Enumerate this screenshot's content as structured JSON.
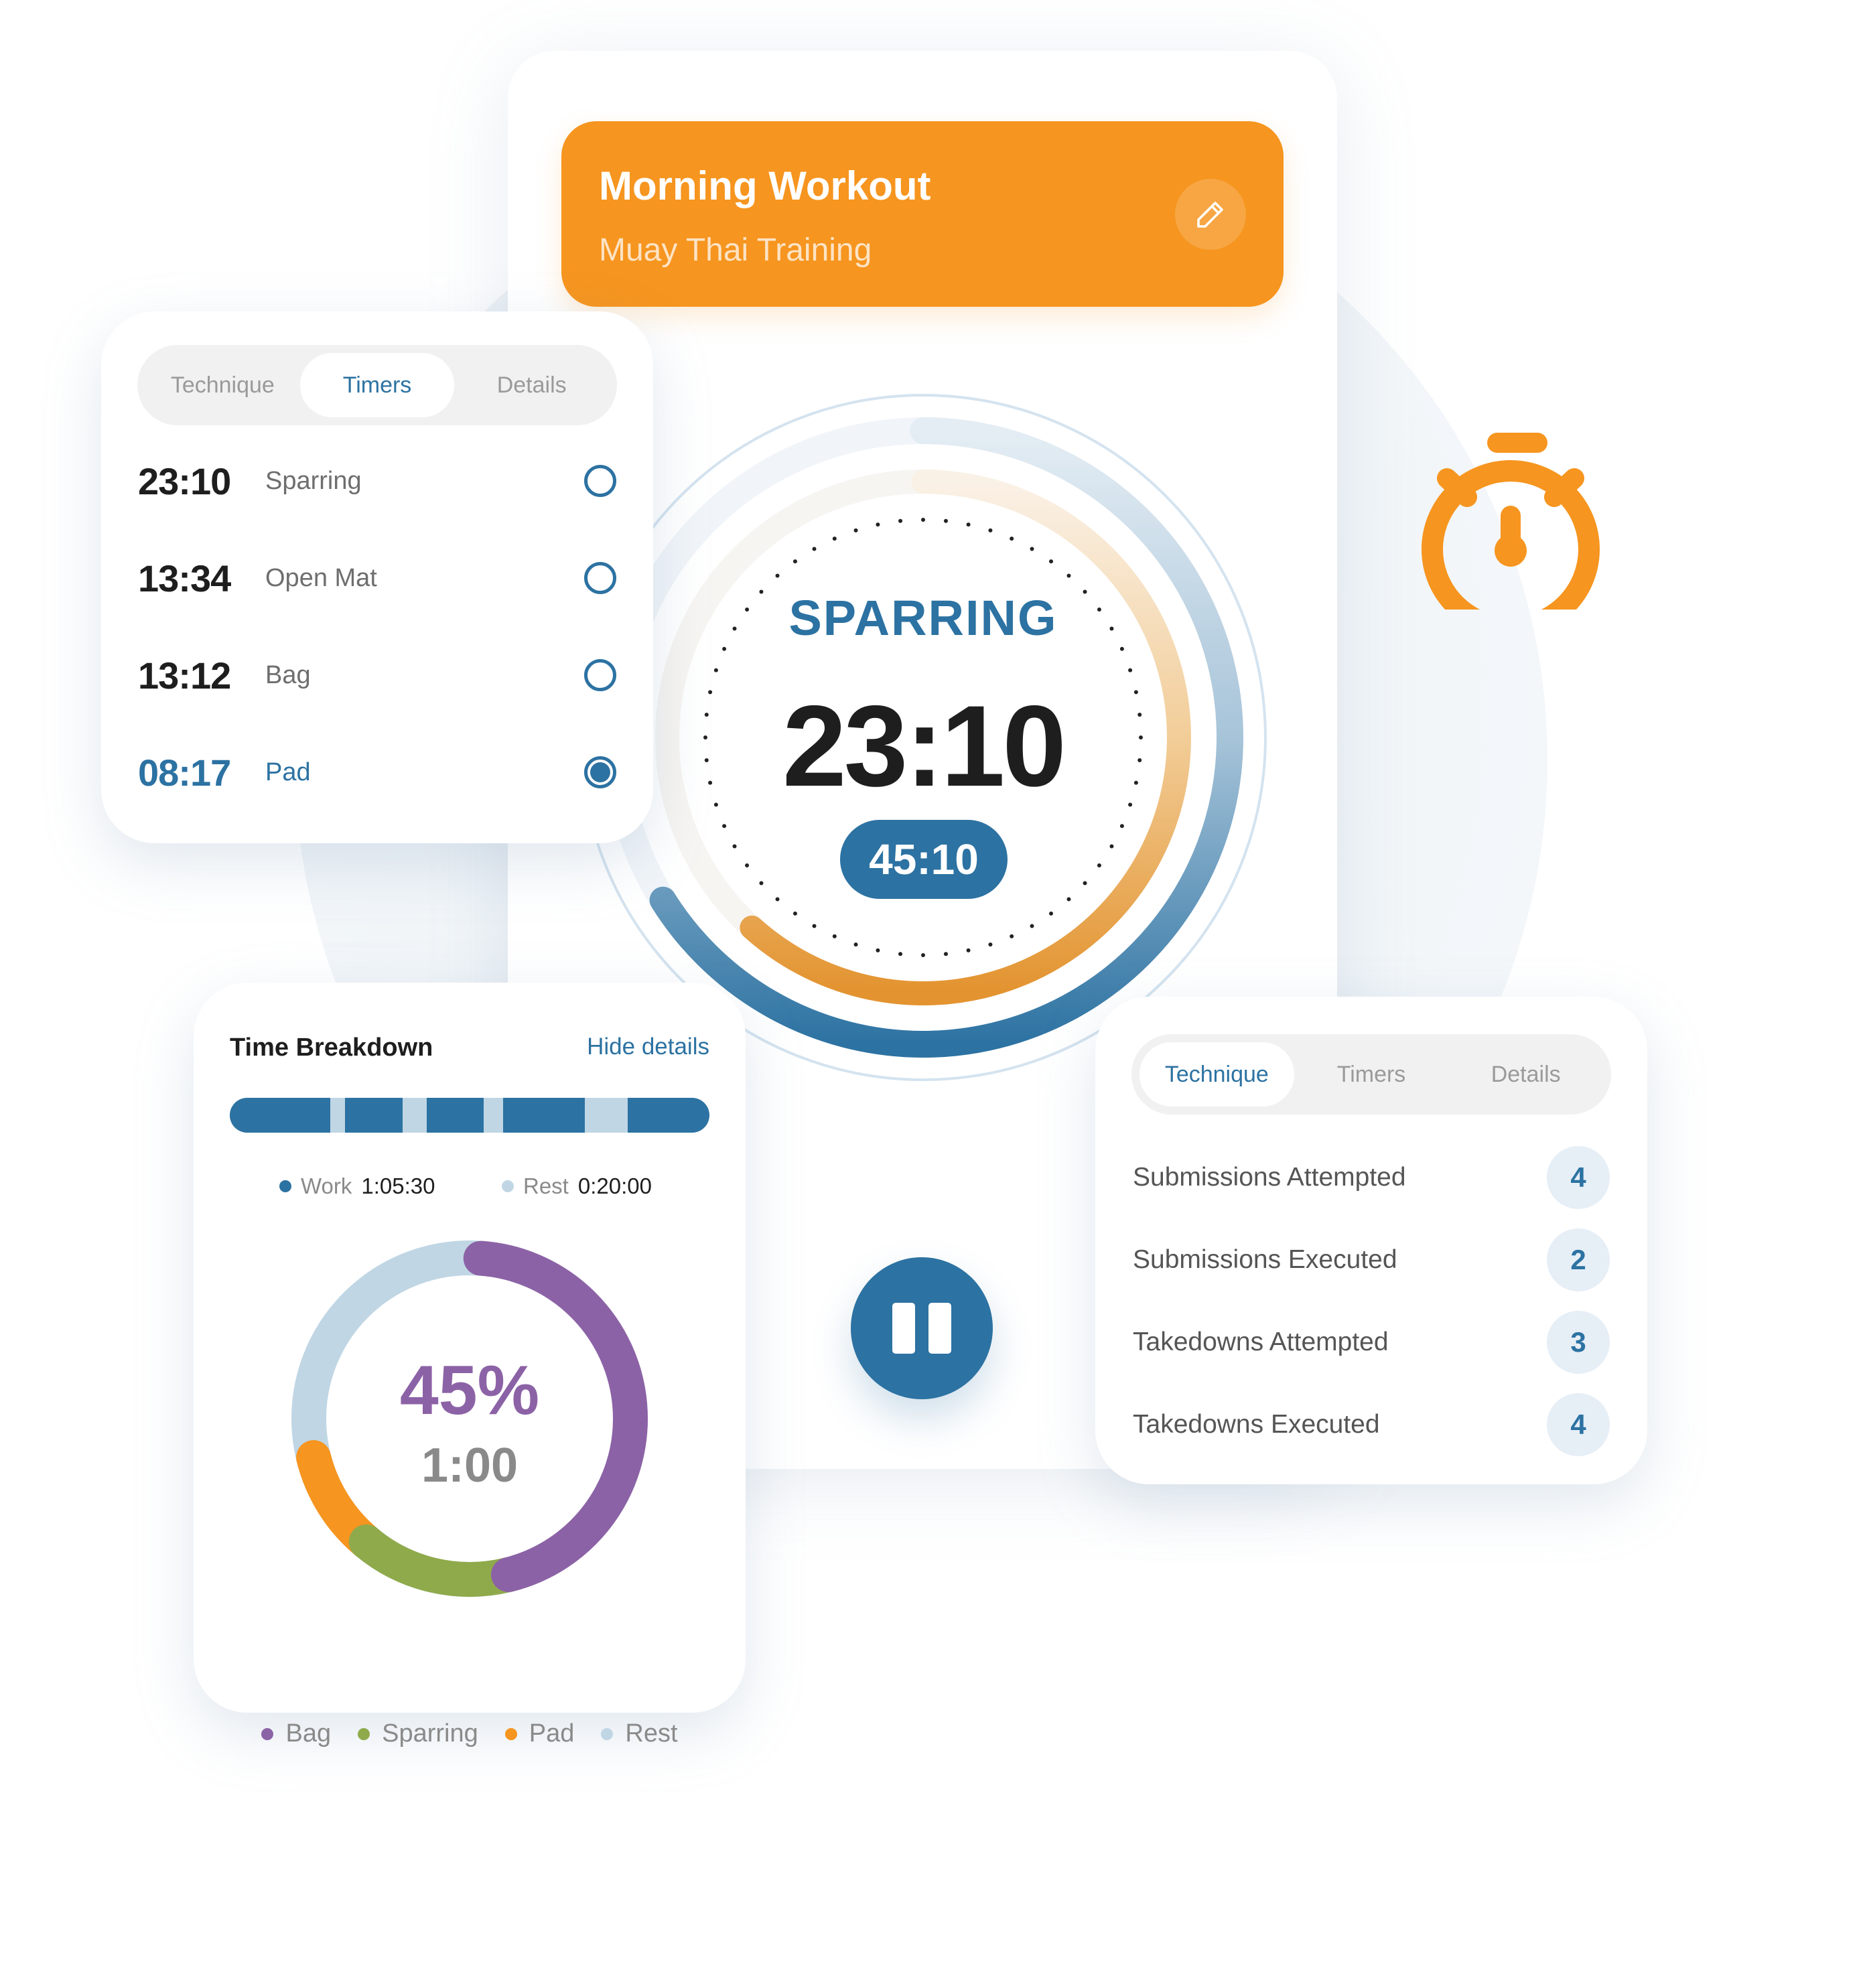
{
  "header": {
    "title": "Morning Workout",
    "subtitle": "Muay Thai Training",
    "edit_icon": "pencil-icon"
  },
  "timers_card": {
    "tabs": [
      {
        "label": "Technique",
        "active": false
      },
      {
        "label": "Timers",
        "active": true
      },
      {
        "label": "Details",
        "active": false
      }
    ],
    "rows": [
      {
        "time": "23:10",
        "label": "Sparring",
        "selected": false
      },
      {
        "time": "13:34",
        "label": "Open Mat",
        "selected": false
      },
      {
        "time": "13:12",
        "label": "Bag",
        "selected": false
      },
      {
        "time": "08:17",
        "label": "Pad",
        "selected": true
      }
    ]
  },
  "dial": {
    "activity": "SPARRING",
    "time": "23:10",
    "total": "45:10",
    "colors": {
      "blue": "#2c72a2",
      "orange": "#f6951f",
      "track": "#e4edf4"
    }
  },
  "pause_button": {
    "icon": "pause-icon"
  },
  "stopwatch_icon": "stopwatch-icon",
  "breakdown_card": {
    "title": "Time Breakdown",
    "link": "Hide details",
    "work_label": "Work",
    "work_value": "1:05:30",
    "rest_label": "Rest",
    "rest_value": "0:20:00",
    "bar_segments": [
      {
        "type": "work",
        "share": 0.21
      },
      {
        "type": "rest",
        "share": 0.03
      },
      {
        "type": "work",
        "share": 0.12
      },
      {
        "type": "rest",
        "share": 0.05
      },
      {
        "type": "work",
        "share": 0.12
      },
      {
        "type": "rest",
        "share": 0.04
      },
      {
        "type": "work",
        "share": 0.17
      },
      {
        "type": "rest",
        "share": 0.09
      },
      {
        "type": "work",
        "share": 0.17
      }
    ],
    "donut_percent": "45%",
    "donut_time": "1:00",
    "legend": [
      {
        "label": "Bag",
        "color": "#8c62a6"
      },
      {
        "label": "Sparring",
        "color": "#8faa4b"
      },
      {
        "label": "Pad",
        "color": "#f6951f"
      },
      {
        "label": "Rest",
        "color": "#c0d6e4"
      }
    ]
  },
  "chart_data": {
    "type": "pie",
    "title": "Time Breakdown",
    "center_labels": [
      "45%",
      "1:00"
    ],
    "categories": [
      "Bag",
      "Sparring",
      "Pad",
      "Rest"
    ],
    "values": [
      45,
      15,
      10,
      30
    ],
    "colors": [
      "#8c62a6",
      "#8faa4b",
      "#f6951f",
      "#c0d6e4"
    ]
  },
  "technique_card": {
    "tabs": [
      {
        "label": "Technique",
        "active": true
      },
      {
        "label": "Timers",
        "active": false
      },
      {
        "label": "Details",
        "active": false
      }
    ],
    "rows": [
      {
        "label": "Submissions Attempted",
        "count": "4"
      },
      {
        "label": "Submissions Executed",
        "count": "2"
      },
      {
        "label": "Takedowns Attempted",
        "count": "3"
      },
      {
        "label": "Takedowns Executed",
        "count": "4"
      }
    ]
  }
}
